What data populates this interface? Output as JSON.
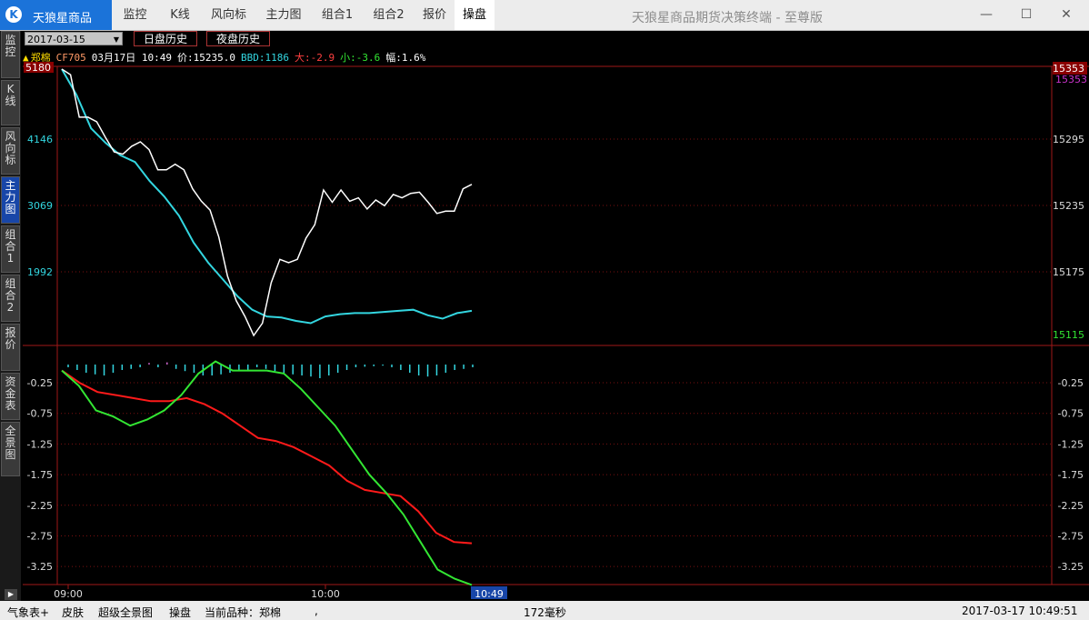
{
  "app": {
    "logo_icon": "k-logo-icon",
    "name": "天狼星商品",
    "title": "天狼星商品期货决策终端 - 至尊版"
  },
  "nav_tabs": [
    "监控",
    "K线",
    "风向标",
    "主力图",
    "组合1",
    "组合2",
    "报价",
    "操盘"
  ],
  "active_nav": "操盘",
  "window_controls": {
    "minimize": "—",
    "maximize": "☐",
    "close": "✕"
  },
  "side_tabs": [
    "监控",
    "K线",
    "风向标",
    "主力图",
    "组合1",
    "组合2",
    "报价",
    "资金表",
    "全景图"
  ],
  "active_side": "主力图",
  "toolbar": {
    "date": "2017-03-15",
    "day_history": "日盘历史",
    "night_history": "夜盘历史"
  },
  "info": {
    "marker": "▲",
    "name": "郑棉",
    "code": "CF705",
    "datetime": "03月17日 10:49",
    "price": "价:15235.0",
    "bbd": "BBD:1186",
    "big": "大:-2.9",
    "small": "小:-3.6",
    "range": "幅:1.6%"
  },
  "colors": {
    "grid": "#7a1010",
    "white_line": "#ffffff",
    "cyan_line": "#33d6e0",
    "red_line": "#ff1a1a",
    "green_line": "#33e633",
    "frame": "#a01818"
  },
  "chart_data": [
    {
      "type": "line",
      "name": "price",
      "ylabels_left": [
        "5180",
        "4146",
        "3069",
        "1992"
      ],
      "ylabels_right": [
        "15353",
        "15295",
        "15235",
        "15175",
        "15115"
      ],
      "ylim": [
        15115,
        15353
      ],
      "series": [
        {
          "values": [
            15353,
            15348,
            15310,
            15310,
            15306,
            15292,
            15279,
            15277,
            15284,
            15288,
            15281,
            15263,
            15263,
            15268,
            15263,
            15246,
            15235,
            15227,
            15203,
            15168,
            15146,
            15132,
            15115,
            15126,
            15162,
            15183,
            15180,
            15183,
            15202,
            15214,
            15245,
            15234,
            15245,
            15235,
            15238,
            15228,
            15236,
            15231,
            15241,
            15238,
            15242,
            15243,
            15234,
            15224,
            15226,
            15226,
            15246,
            15250
          ]
        },
        {
          "values": [
            15353,
            15330,
            15300,
            15287,
            15276,
            15270,
            15253,
            15239,
            15222,
            15198,
            15180,
            15165,
            15150,
            15138,
            15132,
            15131,
            15128,
            15126,
            15132,
            15134,
            15135,
            15135,
            15136,
            15137,
            15138,
            15133,
            15130,
            15135,
            15137
          ]
        }
      ]
    },
    {
      "type": "line",
      "name": "fund flow",
      "ylabels": [
        "-0.25",
        "-0.75",
        "-1.25",
        "-1.75",
        "-2.25",
        "-2.75",
        "-3.25"
      ],
      "ylim": [
        -3.5,
        0.3
      ],
      "series": [
        {
          "values": [
            -0.05,
            -0.25,
            -0.4,
            -0.45,
            -0.5,
            -0.55,
            -0.55,
            -0.5,
            -0.6,
            -0.75,
            -0.95,
            -1.15,
            -1.2,
            -1.3,
            -1.45,
            -1.6,
            -1.85,
            -2.0,
            -2.05,
            -2.1,
            -2.35,
            -2.7,
            -2.85,
            -2.87
          ]
        },
        {
          "values": [
            -0.05,
            -0.3,
            -0.7,
            -0.8,
            -0.95,
            -0.85,
            -0.7,
            -0.45,
            -0.1,
            0.1,
            -0.05,
            -0.05,
            -0.05,
            -0.1,
            -0.35,
            -0.65,
            -0.95,
            -1.35,
            -1.75,
            -2.05,
            -2.4,
            -2.85,
            -3.3,
            -3.45,
            -3.55
          ]
        }
      ],
      "histogram": [
        -0.05,
        -0.1,
        -0.15,
        -0.18,
        -0.2,
        -0.15,
        -0.1,
        -0.08,
        -0.05,
        0.03,
        -0.05,
        0.04,
        -0.08,
        -0.12,
        -0.15,
        -0.2,
        -0.2,
        -0.18,
        -0.15,
        -0.12,
        -0.1,
        -0.05,
        -0.08,
        -0.12,
        -0.15,
        -0.18,
        -0.2,
        -0.22,
        -0.25,
        -0.2,
        -0.15,
        -0.1,
        -0.05,
        -0.04,
        -0.03,
        -0.02,
        -0.05,
        -0.1,
        -0.15,
        -0.2,
        -0.22,
        -0.2,
        -0.15,
        -0.1,
        -0.08,
        -0.05
      ]
    }
  ],
  "x_ticks": [
    "09:00",
    "10:00"
  ],
  "current_time": "10:49",
  "status": {
    "weather": "气象表+",
    "skin": "皮肤",
    "panorama": "超级全景图",
    "trade": "操盘",
    "current": "当前品种：郑棉",
    "comma": ",",
    "latency": "172毫秒",
    "clock": "2017-03-17  10:49:51"
  }
}
